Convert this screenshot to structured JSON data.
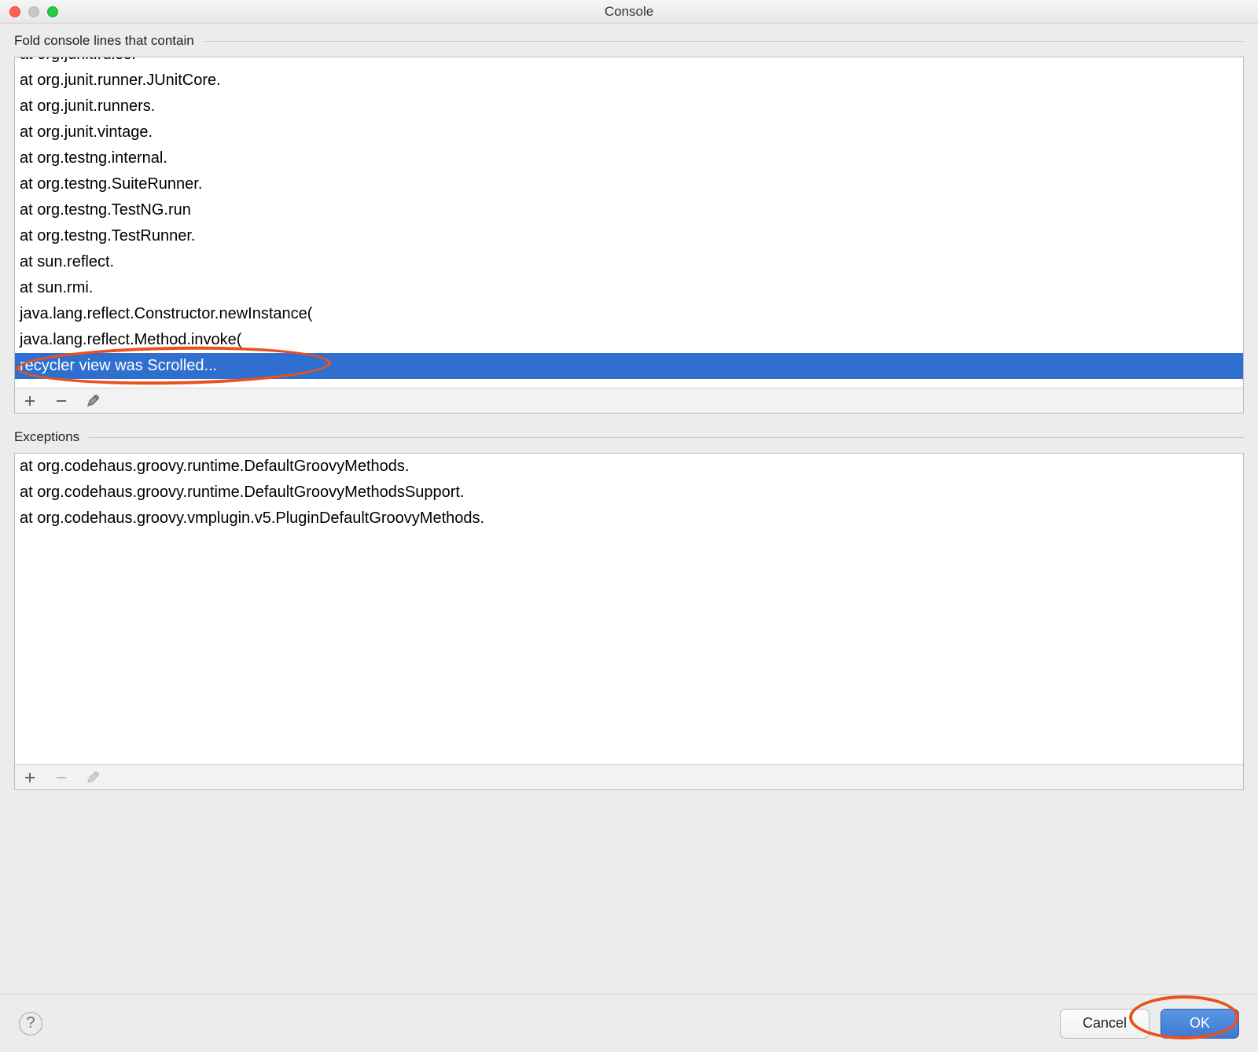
{
  "window": {
    "title": "Console"
  },
  "sections": {
    "fold": {
      "label": "Fold console lines that contain",
      "items": [
        "at org.junit.rules.",
        "at org.junit.runner.JUnitCore.",
        "at org.junit.runners.",
        "at org.junit.vintage.",
        "at org.testng.internal.",
        "at org.testng.SuiteRunner.",
        "at org.testng.TestNG.run",
        "at org.testng.TestRunner.",
        "at sun.reflect.",
        "at sun.rmi.",
        "java.lang.reflect.Constructor.newInstance(",
        "java.lang.reflect.Method.invoke(",
        "recycler view was Scrolled..."
      ],
      "selected_index": 12
    },
    "exceptions": {
      "label": "Exceptions",
      "items": [
        "at org.codehaus.groovy.runtime.DefaultGroovyMethods.",
        "at org.codehaus.groovy.runtime.DefaultGroovyMethodsSupport.",
        "at org.codehaus.groovy.vmplugin.v5.PluginDefaultGroovyMethods."
      ],
      "selected_index": -1
    }
  },
  "toolbar": {
    "add": "+",
    "remove": "−",
    "edit": "edit"
  },
  "footer": {
    "help": "?",
    "cancel": "Cancel",
    "ok": "OK"
  }
}
